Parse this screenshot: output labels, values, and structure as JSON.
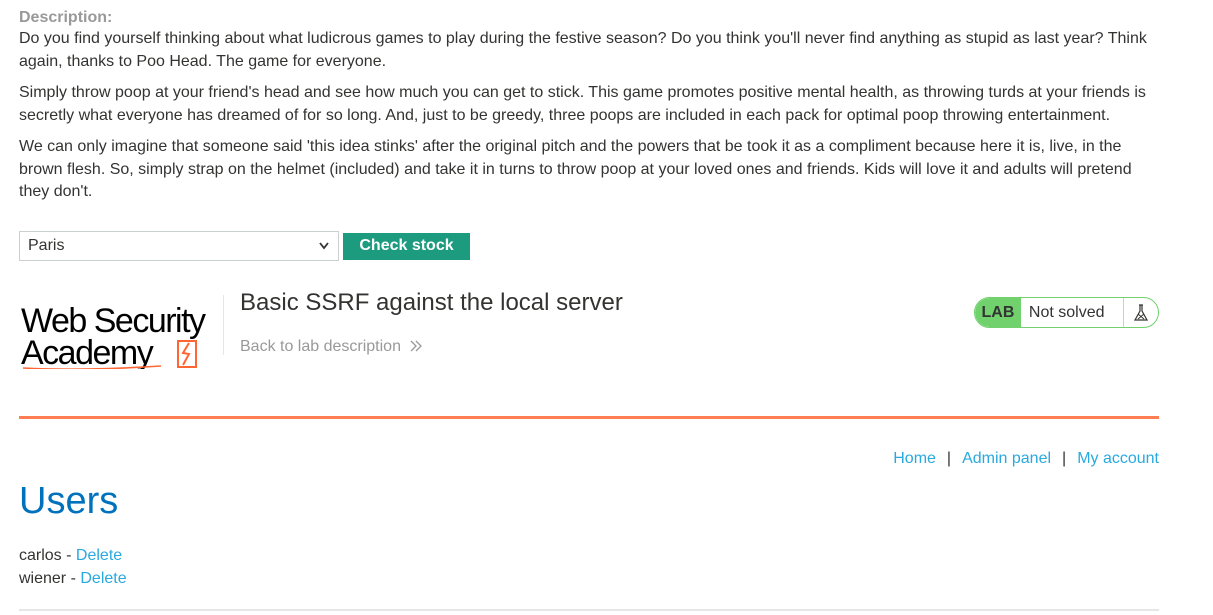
{
  "description": {
    "heading": "Description:",
    "paragraphs": [
      "Do you find yourself thinking about what ludicrous games to play during the festive season? Do you think you'll never find anything as stupid as last year? Think again, thanks to Poo Head. The game for everyone.",
      "Simply throw poop at your friend's head and see how much you can get to stick. This game promotes positive mental health, as throwing turds at your friends is secretly what everyone has dreamed of for so long. And, just to be greedy, three poops are included in each pack for optimal poop throwing entertainment.",
      "We can only imagine that someone said 'this idea stinks' after the original pitch and the powers that be took it as a compliment because here it is, live, in the brown flesh. So, simply strap on the helmet (included) and take it in turns to throw poop at your loved ones and friends. Kids will love it and adults will pretend they don't."
    ]
  },
  "stock": {
    "selected_store": "Paris",
    "button_label": "Check stock"
  },
  "lab": {
    "logo_line1": "Web Security",
    "logo_line2": "Academy",
    "title": "Basic SSRF against the local server",
    "back_link": "Back to lab description",
    "badge": "LAB",
    "status": "Not solved",
    "colors": {
      "accent_orange": "#ff6633",
      "lab_green": "#70d16d",
      "button_teal": "#1d9b7f",
      "link_blue": "#29a9de",
      "heading_blue": "#0071bc"
    }
  },
  "nav": {
    "home": "Home",
    "separator": "|",
    "admin_panel": "Admin panel",
    "my_account": "My account"
  },
  "users": {
    "title": "Users",
    "rows": [
      {
        "name": "carlos",
        "dash": " - ",
        "action": "Delete"
      },
      {
        "name": "wiener",
        "dash": " - ",
        "action": "Delete"
      }
    ]
  }
}
